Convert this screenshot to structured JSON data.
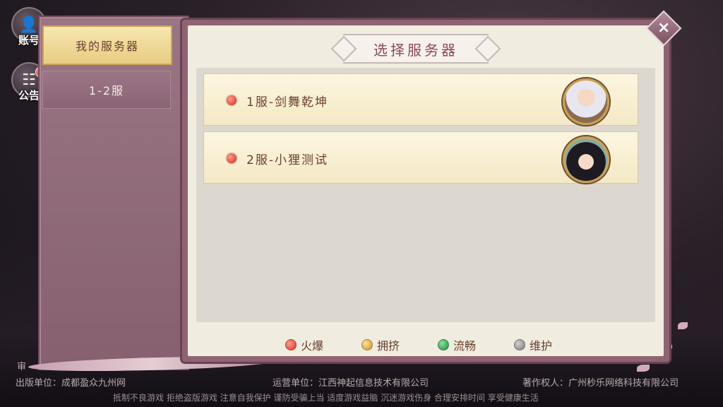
{
  "sidebar": {
    "account_label": "账号",
    "notice_label": "公告"
  },
  "tabs": [
    {
      "label": "我的服务器"
    },
    {
      "label": "1-2服"
    }
  ],
  "dialog": {
    "title": "选择服务器",
    "close": "×"
  },
  "servers": [
    {
      "name": "1服-剑舞乾坤",
      "status_color": "#d8322a"
    },
    {
      "name": "2服-小狸测试",
      "status_color": "#d8322a"
    }
  ],
  "legend": [
    {
      "label": "火爆",
      "color": "#e04a3a"
    },
    {
      "label": "拥挤",
      "color": "#d8a43a"
    },
    {
      "label": "流畅",
      "color": "#2a9a4a"
    },
    {
      "label": "维护",
      "color": "#8a8a8a"
    }
  ],
  "footer": {
    "publisher": "出版单位：成都盈众九州网",
    "operator": "运营单位：江西神起信息技术有限公司",
    "copyright": "著作权人：广州秒乐网络科技有限公司",
    "notice": "抵制不良游戏 拒绝盗版游戏 注意自我保护 谨防受骗上当 适度游戏益脑 沉迷游戏伤身 合理安排时间 享受健康生活",
    "review": "审"
  }
}
